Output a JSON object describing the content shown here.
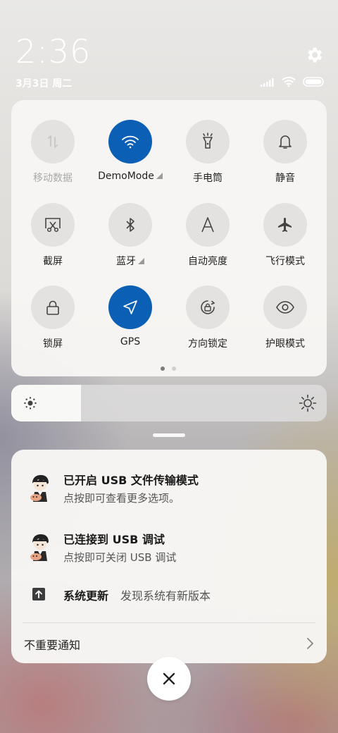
{
  "status": {
    "time": "2:36",
    "date": "3月3日 周二"
  },
  "quick_settings": {
    "tiles": [
      {
        "label": "移动数据",
        "icon": "mobile-data-icon",
        "state": "disabled"
      },
      {
        "label": "DemoMode",
        "icon": "wifi-icon",
        "state": "active"
      },
      {
        "label": "手电筒",
        "icon": "flashlight-icon",
        "state": "off"
      },
      {
        "label": "静音",
        "icon": "bell-icon",
        "state": "off"
      },
      {
        "label": "截屏",
        "icon": "screenshot-icon",
        "state": "off"
      },
      {
        "label": "蓝牙",
        "icon": "bluetooth-icon",
        "state": "off"
      },
      {
        "label": "自动亮度",
        "icon": "auto-brightness-icon",
        "state": "off"
      },
      {
        "label": "飞行模式",
        "icon": "airplane-icon",
        "state": "off"
      },
      {
        "label": "锁屏",
        "icon": "lock-icon",
        "state": "off"
      },
      {
        "label": "GPS",
        "icon": "location-arrow-icon",
        "state": "active"
      },
      {
        "label": "方向锁定",
        "icon": "rotation-lock-icon",
        "state": "off"
      },
      {
        "label": "护眼模式",
        "icon": "eye-icon",
        "state": "off"
      }
    ],
    "page_indicator": {
      "current": 1,
      "total": 2
    },
    "active_color": "#0b5fb5"
  },
  "brightness": {
    "level": 0.22
  },
  "notifications": [
    {
      "title": "已开启 USB 文件传输模式",
      "text": "点按即可查看更多选项。"
    },
    {
      "title": "已连接到 USB 调试",
      "text": "点按即可关闭 USB 调试"
    },
    {
      "title": "系统更新",
      "text": "发现系统有新版本"
    }
  ],
  "unimportant_label": "不重要通知"
}
